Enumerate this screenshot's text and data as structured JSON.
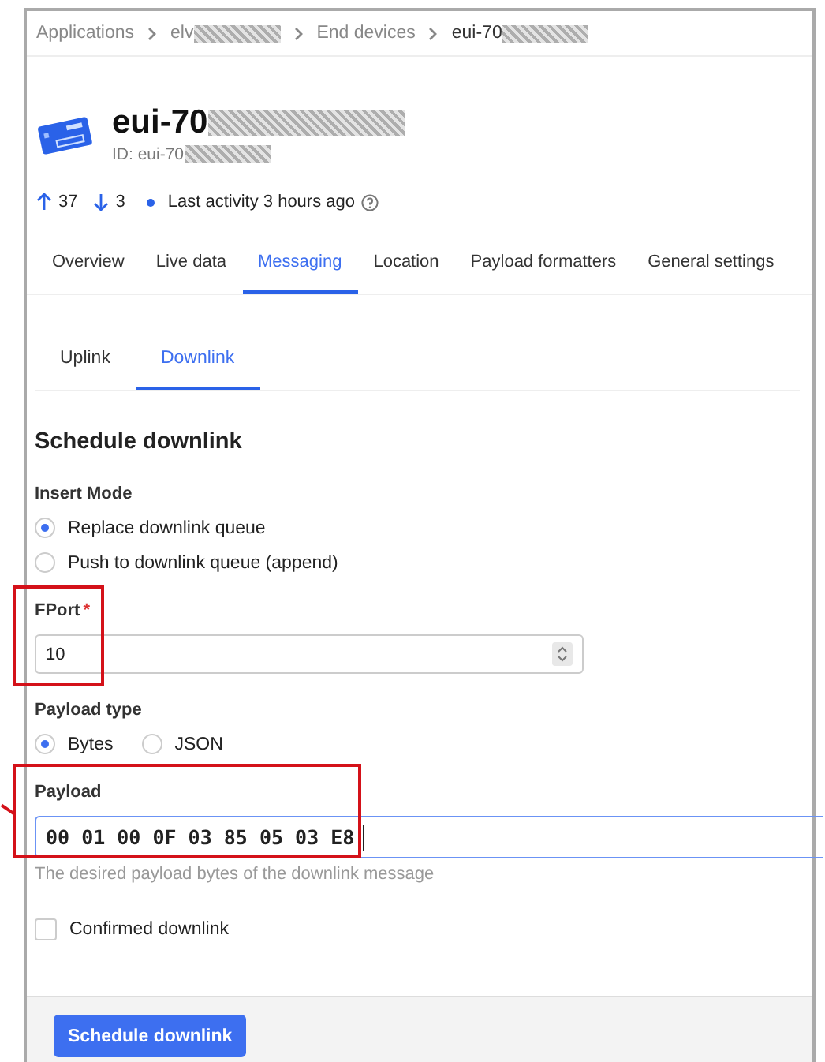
{
  "breadcrumb": [
    {
      "label": "Applications",
      "redacted": false,
      "current": false
    },
    {
      "label": "elv",
      "redacted": true,
      "current": false
    },
    {
      "label": "End devices",
      "redacted": false,
      "current": false
    },
    {
      "label": "eui-70",
      "redacted": true,
      "current": true
    }
  ],
  "device": {
    "name": "eui-70",
    "id": "ID: eui-70"
  },
  "stats": {
    "uplinks": "37",
    "downlinks": "3",
    "activity": "Last activity 3 hours ago"
  },
  "tabs": [
    {
      "label": "Overview",
      "selected": false
    },
    {
      "label": "Live data",
      "selected": false
    },
    {
      "label": "Messaging",
      "selected": true
    },
    {
      "label": "Location",
      "selected": false
    },
    {
      "label": "Payload formatters",
      "selected": false
    },
    {
      "label": "General settings",
      "selected": false
    }
  ],
  "subtabs": [
    {
      "label": "Uplink",
      "selected": false
    },
    {
      "label": "Downlink",
      "selected": true
    }
  ],
  "form": {
    "title": "Schedule downlink",
    "insert_mode": {
      "label": "Insert Mode",
      "options": [
        {
          "label": "Replace downlink queue",
          "selected": true
        },
        {
          "label": "Push to downlink queue (append)",
          "selected": false
        }
      ]
    },
    "fport": {
      "label": "FPort",
      "required_mark": "*",
      "value": "10",
      "highlighted": true
    },
    "payload_type": {
      "label": "Payload type",
      "options": [
        {
          "label": "Bytes",
          "selected": true
        },
        {
          "label": "JSON",
          "selected": false
        }
      ]
    },
    "payload": {
      "label": "Payload",
      "value": "00 01 00 0F 03 85 05 03 E8",
      "hint": "The desired payload bytes of the downlink message",
      "highlighted": true
    },
    "confirmed": {
      "label": "Confirmed downlink",
      "checked": false
    },
    "submit": "Schedule downlink"
  }
}
